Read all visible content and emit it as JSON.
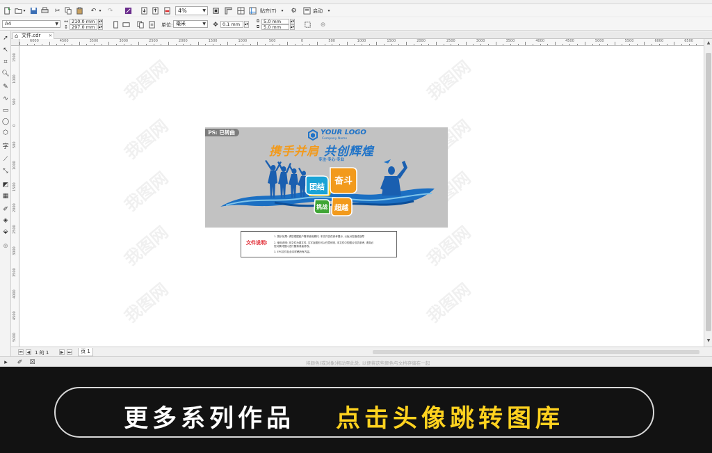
{
  "toolbar": {
    "zoom": "4%",
    "snap_label": "贴齐(T)",
    "launch_label": "启动"
  },
  "property_bar": {
    "page_size": "A4",
    "width": "210.0 mm",
    "height": "297.0 mm",
    "units_label": "单位:",
    "units_value": "毫米",
    "nudge": "0.1 mm",
    "dup_x": "5.0 mm",
    "dup_y": "5.0 mm"
  },
  "document_tab": {
    "label": "文件.cdr"
  },
  "ruler": {
    "top_labels": [
      "6000",
      "4500",
      "3500",
      "3000",
      "2500",
      "2000",
      "1500",
      "1000",
      "500",
      "0",
      "500",
      "1000",
      "1500",
      "2000",
      "2500",
      "3000",
      "3500",
      "4000",
      "4500",
      "5000",
      "5500",
      "6000",
      "6500"
    ],
    "left_labels": [
      "1500",
      "1000",
      "500",
      "0",
      "500",
      "1000",
      "1500",
      "2000",
      "2500",
      "3000",
      "3500",
      "4000",
      "4500",
      "5000"
    ]
  },
  "artwork": {
    "ps_badge": "PS: 已转曲",
    "logo_text": "YOUR LOGO",
    "logo_sub": "Company Name",
    "slogan_orange": "携手并肩",
    "slogan_blue": "共创辉煌",
    "motto": "专注·专心·专业",
    "badges": {
      "unity": "团结",
      "strive": "奋斗",
      "challenge": "挑战",
      "surpass": "超越"
    },
    "colors": {
      "orange": "#f29a1c",
      "blue": "#1f73c8",
      "green": "#3fa535",
      "yellow": "#f5c518",
      "teal": "#1aa3d6"
    }
  },
  "notes": {
    "title": "文件说明:",
    "lines": [
      "1. 展示效果: 请您根据客户需求使用素材, 本文件仅供参考展示, 以免对您造成误导",
      "2. 使用说明: 本文件为源文件, 文字及图形可以任意修改, 本文件中的图片仅供参考, 请务必",
      "   您对素材图片进行替换或者修改。",
      "3. EPS文件包含本样稿所有内容。"
    ]
  },
  "watermark_text": "我图网",
  "page_nav": {
    "page_count": "1 的 1",
    "page_tab": "页 1"
  },
  "status": {
    "hint": "将颜色(或对象)拖动至此处, 以便将这些颜色与文档存储在一起"
  },
  "banner": {
    "left_text": "更多系列作品",
    "right_text": "点击头像跳转图库"
  }
}
